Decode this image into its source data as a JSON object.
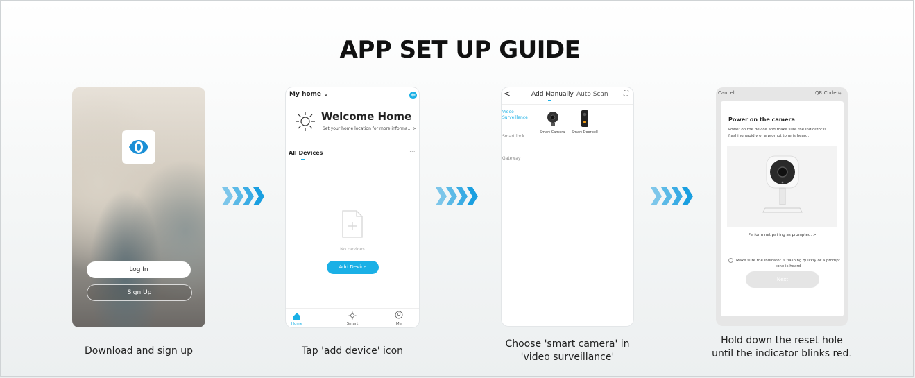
{
  "title": "APP SET UP GUIDE",
  "steps": [
    {
      "caption": "Download and sign up",
      "screen": {
        "login_label": "Log In",
        "signup_label": "Sign Up",
        "logo_icon": "eye-logo-icon"
      }
    },
    {
      "caption": "Tap 'add device' icon",
      "screen": {
        "home_label": "My home ⌄",
        "add_icon": "+",
        "welcome_title": "Welcome Home",
        "welcome_sub": "Set your home location for more informa...  >",
        "all_devices": "All Devices",
        "more_label": "···",
        "no_devices": "No devices",
        "add_device_label": "Add Device",
        "nav": [
          "Home",
          "Smart",
          "Me"
        ]
      }
    },
    {
      "caption_lines": [
        "Choose 'smart camera' in",
        "'video surveillance'"
      ],
      "screen": {
        "back_label": "<",
        "tab_manual": "Add Manually",
        "tab_scan": "Auto Scan",
        "categories": [
          "Video Surveillance",
          "Smart lock",
          "Gateway"
        ],
        "devices": [
          "Smart Camera",
          "Smart Doorbell"
        ]
      }
    },
    {
      "caption_lines": [
        "Hold down the reset hole",
        "until the indicator blinks red."
      ],
      "screen": {
        "cancel_label": "Cancel",
        "qr_label": "QR Code ⇆",
        "heading": "Power on the camera",
        "description": "Power on the device and make sure the indicator is flashing rapidly or a prompt tone is heard.",
        "pairing_link": "Perform net pairing as prompted. >",
        "check_text": "Make sure the indicator is flashing quickly or a prompt tone is heard",
        "next_label": "Next"
      }
    }
  ],
  "colors": {
    "accent": "#1ab0e6",
    "arrow": "#1a9fe0"
  }
}
